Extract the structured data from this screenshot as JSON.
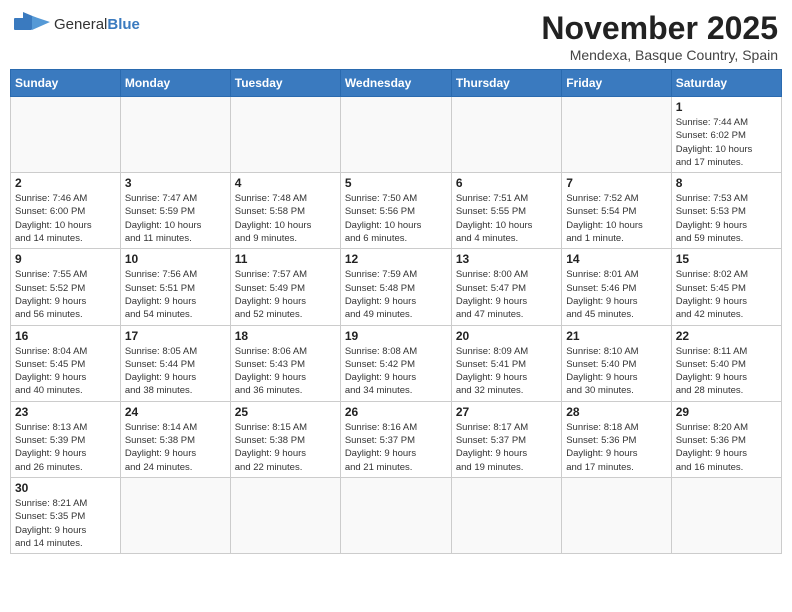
{
  "logo": {
    "text_general": "General",
    "text_blue": "Blue"
  },
  "header": {
    "month": "November 2025",
    "location": "Mendexa, Basque Country, Spain"
  },
  "weekdays": [
    "Sunday",
    "Monday",
    "Tuesday",
    "Wednesday",
    "Thursday",
    "Friday",
    "Saturday"
  ],
  "weeks": [
    [
      {
        "day": "",
        "info": ""
      },
      {
        "day": "",
        "info": ""
      },
      {
        "day": "",
        "info": ""
      },
      {
        "day": "",
        "info": ""
      },
      {
        "day": "",
        "info": ""
      },
      {
        "day": "",
        "info": ""
      },
      {
        "day": "1",
        "info": "Sunrise: 7:44 AM\nSunset: 6:02 PM\nDaylight: 10 hours\nand 17 minutes."
      }
    ],
    [
      {
        "day": "2",
        "info": "Sunrise: 7:46 AM\nSunset: 6:00 PM\nDaylight: 10 hours\nand 14 minutes."
      },
      {
        "day": "3",
        "info": "Sunrise: 7:47 AM\nSunset: 5:59 PM\nDaylight: 10 hours\nand 11 minutes."
      },
      {
        "day": "4",
        "info": "Sunrise: 7:48 AM\nSunset: 5:58 PM\nDaylight: 10 hours\nand 9 minutes."
      },
      {
        "day": "5",
        "info": "Sunrise: 7:50 AM\nSunset: 5:56 PM\nDaylight: 10 hours\nand 6 minutes."
      },
      {
        "day": "6",
        "info": "Sunrise: 7:51 AM\nSunset: 5:55 PM\nDaylight: 10 hours\nand 4 minutes."
      },
      {
        "day": "7",
        "info": "Sunrise: 7:52 AM\nSunset: 5:54 PM\nDaylight: 10 hours\nand 1 minute."
      },
      {
        "day": "8",
        "info": "Sunrise: 7:53 AM\nSunset: 5:53 PM\nDaylight: 9 hours\nand 59 minutes."
      }
    ],
    [
      {
        "day": "9",
        "info": "Sunrise: 7:55 AM\nSunset: 5:52 PM\nDaylight: 9 hours\nand 56 minutes."
      },
      {
        "day": "10",
        "info": "Sunrise: 7:56 AM\nSunset: 5:51 PM\nDaylight: 9 hours\nand 54 minutes."
      },
      {
        "day": "11",
        "info": "Sunrise: 7:57 AM\nSunset: 5:49 PM\nDaylight: 9 hours\nand 52 minutes."
      },
      {
        "day": "12",
        "info": "Sunrise: 7:59 AM\nSunset: 5:48 PM\nDaylight: 9 hours\nand 49 minutes."
      },
      {
        "day": "13",
        "info": "Sunrise: 8:00 AM\nSunset: 5:47 PM\nDaylight: 9 hours\nand 47 minutes."
      },
      {
        "day": "14",
        "info": "Sunrise: 8:01 AM\nSunset: 5:46 PM\nDaylight: 9 hours\nand 45 minutes."
      },
      {
        "day": "15",
        "info": "Sunrise: 8:02 AM\nSunset: 5:45 PM\nDaylight: 9 hours\nand 42 minutes."
      }
    ],
    [
      {
        "day": "16",
        "info": "Sunrise: 8:04 AM\nSunset: 5:45 PM\nDaylight: 9 hours\nand 40 minutes."
      },
      {
        "day": "17",
        "info": "Sunrise: 8:05 AM\nSunset: 5:44 PM\nDaylight: 9 hours\nand 38 minutes."
      },
      {
        "day": "18",
        "info": "Sunrise: 8:06 AM\nSunset: 5:43 PM\nDaylight: 9 hours\nand 36 minutes."
      },
      {
        "day": "19",
        "info": "Sunrise: 8:08 AM\nSunset: 5:42 PM\nDaylight: 9 hours\nand 34 minutes."
      },
      {
        "day": "20",
        "info": "Sunrise: 8:09 AM\nSunset: 5:41 PM\nDaylight: 9 hours\nand 32 minutes."
      },
      {
        "day": "21",
        "info": "Sunrise: 8:10 AM\nSunset: 5:40 PM\nDaylight: 9 hours\nand 30 minutes."
      },
      {
        "day": "22",
        "info": "Sunrise: 8:11 AM\nSunset: 5:40 PM\nDaylight: 9 hours\nand 28 minutes."
      }
    ],
    [
      {
        "day": "23",
        "info": "Sunrise: 8:13 AM\nSunset: 5:39 PM\nDaylight: 9 hours\nand 26 minutes."
      },
      {
        "day": "24",
        "info": "Sunrise: 8:14 AM\nSunset: 5:38 PM\nDaylight: 9 hours\nand 24 minutes."
      },
      {
        "day": "25",
        "info": "Sunrise: 8:15 AM\nSunset: 5:38 PM\nDaylight: 9 hours\nand 22 minutes."
      },
      {
        "day": "26",
        "info": "Sunrise: 8:16 AM\nSunset: 5:37 PM\nDaylight: 9 hours\nand 21 minutes."
      },
      {
        "day": "27",
        "info": "Sunrise: 8:17 AM\nSunset: 5:37 PM\nDaylight: 9 hours\nand 19 minutes."
      },
      {
        "day": "28",
        "info": "Sunrise: 8:18 AM\nSunset: 5:36 PM\nDaylight: 9 hours\nand 17 minutes."
      },
      {
        "day": "29",
        "info": "Sunrise: 8:20 AM\nSunset: 5:36 PM\nDaylight: 9 hours\nand 16 minutes."
      }
    ],
    [
      {
        "day": "30",
        "info": "Sunrise: 8:21 AM\nSunset: 5:35 PM\nDaylight: 9 hours\nand 14 minutes."
      },
      {
        "day": "",
        "info": ""
      },
      {
        "day": "",
        "info": ""
      },
      {
        "day": "",
        "info": ""
      },
      {
        "day": "",
        "info": ""
      },
      {
        "day": "",
        "info": ""
      },
      {
        "day": "",
        "info": ""
      }
    ]
  ]
}
